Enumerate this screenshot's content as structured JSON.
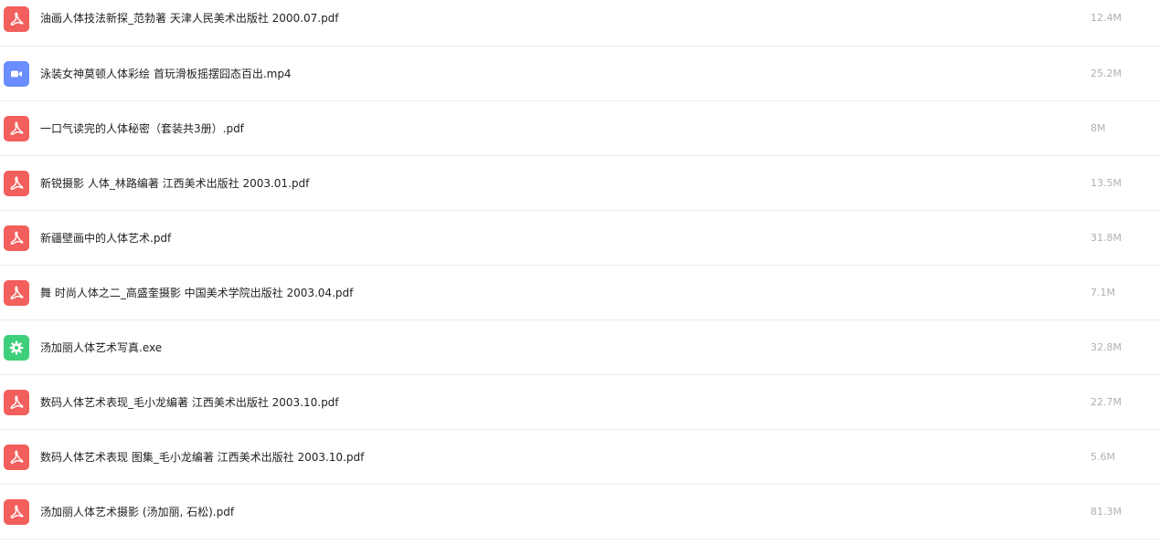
{
  "files": [
    {
      "name": "油画人体技法新探_范勃著 天津人民美术出版社 2000.07.pdf",
      "size": "12.4M",
      "type": "pdf",
      "icon": "pdf-icon"
    },
    {
      "name": "泳装女神莫顿人体彩绘 首玩滑板摇摆囧态百出.mp4",
      "size": "25.2M",
      "type": "video",
      "icon": "video-icon"
    },
    {
      "name": "一口气读完的人体秘密（套装共3册）.pdf",
      "size": "8M",
      "type": "pdf",
      "icon": "pdf-icon"
    },
    {
      "name": "新锐摄影 人体_林路编著 江西美术出版社 2003.01.pdf",
      "size": "13.5M",
      "type": "pdf",
      "icon": "pdf-icon"
    },
    {
      "name": "新疆壁画中的人体艺术.pdf",
      "size": "31.8M",
      "type": "pdf",
      "icon": "pdf-icon"
    },
    {
      "name": "舞 时尚人体之二_高盛奎摄影 中国美术学院出版社 2003.04.pdf",
      "size": "7.1M",
      "type": "pdf",
      "icon": "pdf-icon"
    },
    {
      "name": "汤加丽人体艺术写真.exe",
      "size": "32.8M",
      "type": "exe",
      "icon": "gear-icon"
    },
    {
      "name": "数码人体艺术表现_毛小龙编著 江西美术出版社 2003.10.pdf",
      "size": "22.7M",
      "type": "pdf",
      "icon": "pdf-icon"
    },
    {
      "name": "数码人体艺术表现 图集_毛小龙编著 江西美术出版社 2003.10.pdf",
      "size": "5.6M",
      "type": "pdf",
      "icon": "pdf-icon"
    },
    {
      "name": "汤加丽人体艺术摄影 (汤加丽, 石松).pdf",
      "size": "81.3M",
      "type": "pdf",
      "icon": "pdf-icon"
    }
  ],
  "colors": {
    "pdf": "#f25f5c",
    "video": "#6a8dff",
    "exe": "#3ecf7a",
    "divider": "#ececec",
    "size_text": "#b0b0b0"
  }
}
